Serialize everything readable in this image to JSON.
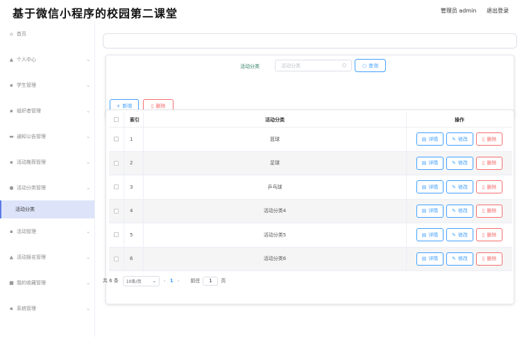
{
  "header": {
    "title": "基于微信小程序的校园第二课堂",
    "user_label": "管理员 admin",
    "logout_label": "退出登录"
  },
  "sidebar": {
    "items": [
      {
        "icon": "home-icon",
        "glyph": "⌂",
        "label": "首页",
        "has_arrow": false
      },
      {
        "icon": "user-icon",
        "glyph": "▲",
        "label": "个人中心",
        "has_arrow": true
      },
      {
        "icon": "grid-icon",
        "glyph": "▪",
        "label": "学生管理",
        "has_arrow": true
      },
      {
        "icon": "grid-icon",
        "glyph": "▪",
        "label": "组织者管理",
        "has_arrow": true
      },
      {
        "icon": "lock-icon",
        "glyph": "▬",
        "label": "通知公告管理",
        "has_arrow": true
      },
      {
        "icon": "grid-icon",
        "glyph": "▪",
        "label": "活动推荐管理",
        "has_arrow": true
      },
      {
        "icon": "doc-icon",
        "glyph": "●",
        "label": "活动分类管理",
        "has_arrow": true,
        "expanded": true,
        "children": [
          "活动分类"
        ]
      },
      {
        "icon": "grid-icon",
        "glyph": "▪",
        "label": "活动管理",
        "has_arrow": true
      },
      {
        "icon": "user-icon",
        "glyph": "▲",
        "label": "活动报名管理",
        "has_arrow": true
      },
      {
        "icon": "folder-icon",
        "glyph": "■",
        "label": "我的收藏管理",
        "has_arrow": true
      },
      {
        "icon": "grid-icon",
        "glyph": "▪",
        "label": "系统管理",
        "has_arrow": true
      }
    ],
    "arrow_glyph": "⌄"
  },
  "search": {
    "label": "活动分类",
    "placeholder": "活动分类",
    "value": "",
    "query_label": "查询",
    "query_glyph": "○"
  },
  "actions": {
    "add_label": "新增",
    "add_glyph": "+",
    "delete_label": "删除",
    "delete_glyph": "▯"
  },
  "table": {
    "columns": [
      "索引",
      "活动分类",
      "操作"
    ],
    "rows": [
      {
        "index": "1",
        "name": "篮球"
      },
      {
        "index": "2",
        "name": "足球"
      },
      {
        "index": "3",
        "name": "乒乓球"
      },
      {
        "index": "4",
        "name": "活动分类4"
      },
      {
        "index": "5",
        "name": "活动分类5"
      },
      {
        "index": "6",
        "name": "活动分类6"
      }
    ],
    "op_detail": "详情",
    "op_edit": "修改",
    "op_delete": "删除",
    "op_detail_glyph": "▤",
    "op_edit_glyph": "✎",
    "op_delete_glyph": "▯"
  },
  "pagination": {
    "total_text": "共 6 条",
    "page_size": "10条/页",
    "prev_glyph": "‹",
    "next_glyph": "›",
    "current_page": "1",
    "goto_label": "前往",
    "goto_value": "1",
    "page_suffix": "页"
  },
  "colors": {
    "primary": "#409eff",
    "danger": "#f56c6c",
    "active_menu_bg": "#dde4fa",
    "search_label": "#2f7d66"
  }
}
